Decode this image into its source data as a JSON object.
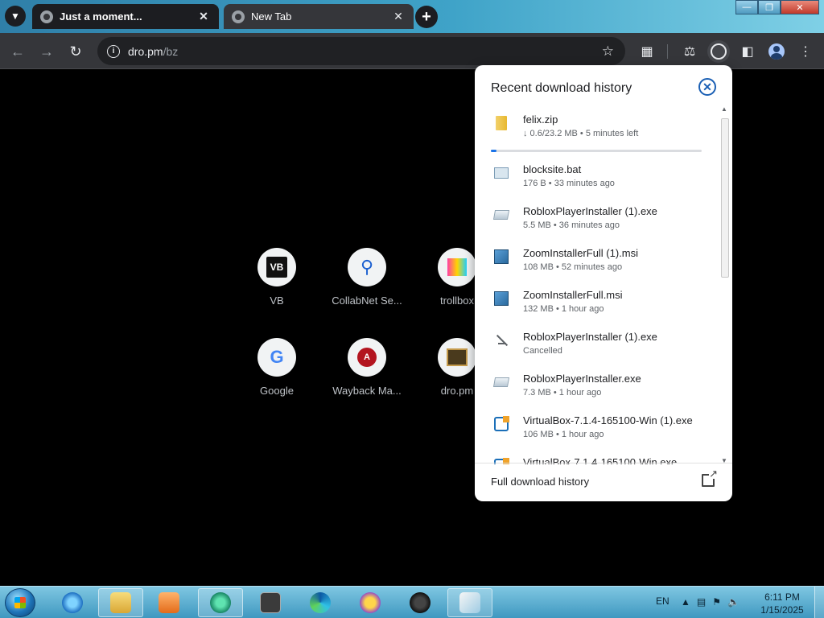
{
  "tabs": [
    {
      "title": "Just a moment...",
      "active": true
    },
    {
      "title": "New Tab",
      "active": false
    }
  ],
  "omnibox": {
    "host": "dro.pm",
    "path": "/bz"
  },
  "shortcuts": [
    {
      "label": "VB",
      "logo": "VB"
    },
    {
      "label": "CollabNet Se...",
      "logo": "search-icon"
    },
    {
      "label": "trollbox",
      "logo": "trollbox-icon"
    },
    {
      "label": "Google",
      "logo": "G"
    },
    {
      "label": "Wayback Ma...",
      "logo": "A"
    },
    {
      "label": "dro.pm",
      "logo": "dro-icon"
    }
  ],
  "downloads": {
    "title": "Recent download history",
    "footer_label": "Full download history",
    "items": [
      {
        "name": "felix.zip",
        "meta": "↓ 0.6/23.2 MB • 5 minutes left",
        "icon": "zip-icon",
        "progress": 0.026
      },
      {
        "name": "blocksite.bat",
        "meta": "176 B • 33 minutes ago",
        "icon": "bat-icon"
      },
      {
        "name": "RobloxPlayerInstaller (1).exe",
        "meta": "5.5 MB • 36 minutes ago",
        "icon": "exe-icon"
      },
      {
        "name": "ZoomInstallerFull (1).msi",
        "meta": "108 MB • 52 minutes ago",
        "icon": "msi-icon"
      },
      {
        "name": "ZoomInstallerFull.msi",
        "meta": "132 MB • 1 hour ago",
        "icon": "msi-icon"
      },
      {
        "name": "RobloxPlayerInstaller (1).exe",
        "meta": "Cancelled",
        "icon": "cancelled-icon"
      },
      {
        "name": "RobloxPlayerInstaller.exe",
        "meta": "7.3 MB • 1 hour ago",
        "icon": "exe-icon"
      },
      {
        "name": "VirtualBox-7.1.4-165100-Win (1).exe",
        "meta": "106 MB • 1 hour ago",
        "icon": "virtualbox-icon"
      },
      {
        "name": "VirtualBox-7.1.4-165100-Win.exe",
        "meta": "",
        "icon": "virtualbox-icon"
      }
    ]
  },
  "taskbar": {
    "language": "EN",
    "time": "6:11 PM",
    "date": "1/15/2025"
  },
  "colors": {
    "accent": "#1a73e8",
    "browser_frame": "#35363a",
    "taskbar": "#3f98c0"
  }
}
